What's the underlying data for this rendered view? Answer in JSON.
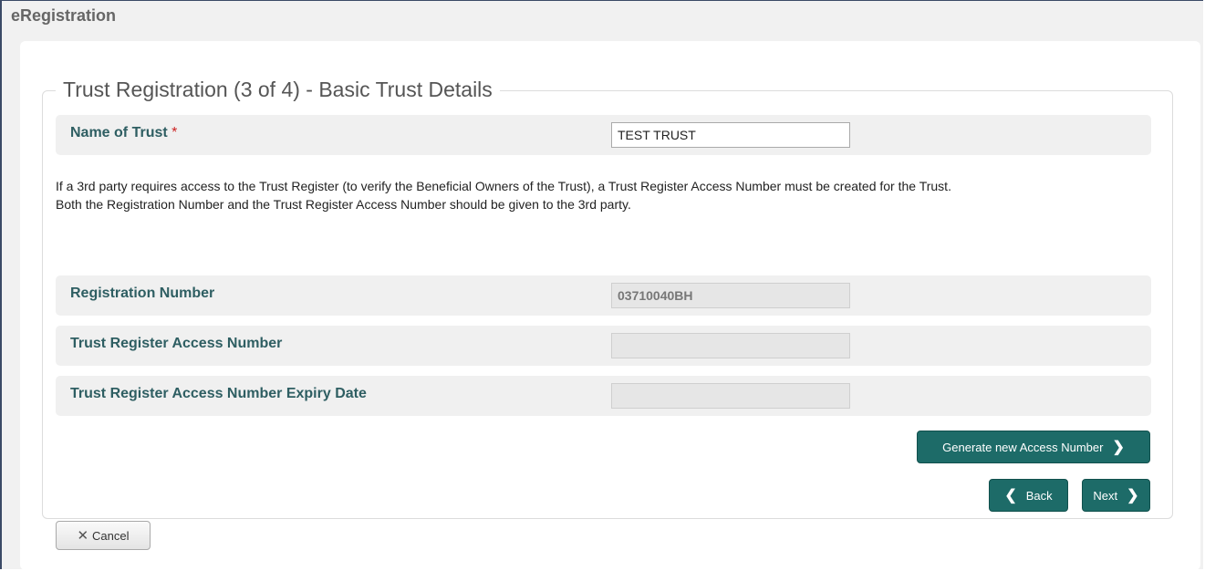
{
  "app": {
    "title": "eRegistration"
  },
  "form": {
    "legend": "Trust Registration (3 of 4) - Basic Trust Details",
    "name_of_trust": {
      "label": "Name of Trust",
      "required_marker": "*",
      "value": "TEST TRUST"
    },
    "info": {
      "line1": "If a 3rd party requires access to the Trust Register (to verify the Beneficial Owners of the Trust), a Trust Register Access Number must be created for the Trust.",
      "line2": "Both the Registration Number and the Trust Register Access Number should be given to the 3rd party."
    },
    "registration_number": {
      "label": "Registration Number",
      "value": "03710040BH"
    },
    "access_number": {
      "label": "Trust Register Access Number",
      "value": ""
    },
    "access_expiry": {
      "label": "Trust Register Access Number Expiry Date",
      "value": ""
    }
  },
  "buttons": {
    "generate": "Generate new Access Number",
    "cancel": "Cancel",
    "back": "Back",
    "next": "Next"
  },
  "icons": {
    "chevron_right": "chevron-right-icon",
    "chevron_left": "chevron-left-icon",
    "close": "close-icon"
  },
  "colors": {
    "accent": "#1d6b68",
    "label": "#2e5e62",
    "required": "#cc2222"
  }
}
